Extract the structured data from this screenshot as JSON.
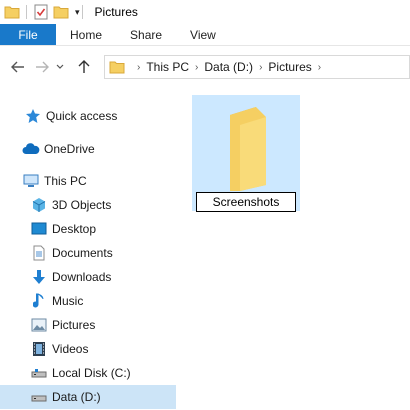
{
  "window": {
    "title": "Pictures"
  },
  "ribbon": {
    "tabs": [
      "File",
      "Home",
      "Share",
      "View"
    ]
  },
  "address": {
    "crumbs": [
      "This PC",
      "Data (D:)",
      "Pictures"
    ]
  },
  "nav": {
    "quick_access": "Quick access",
    "onedrive": "OneDrive",
    "this_pc": "This PC",
    "items": [
      "3D Objects",
      "Desktop",
      "Documents",
      "Downloads",
      "Music",
      "Pictures",
      "Videos",
      "Local Disk (C:)",
      "Data (D:)"
    ]
  },
  "content": {
    "rename_value": "Screenshots"
  },
  "colors": {
    "accent": "#1979ca",
    "selection": "#cce4f7",
    "folder_selected": "#cce8ff",
    "folder_yellow": "#f5cf62"
  }
}
